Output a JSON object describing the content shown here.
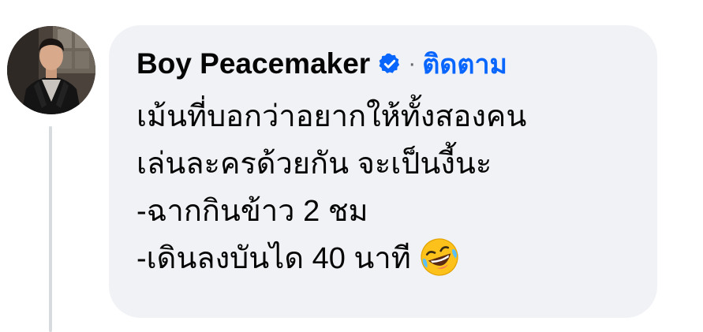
{
  "comment": {
    "author": "Boy Peacemaker",
    "separator": "·",
    "follow_label": "ติดตาม",
    "lines": [
      "เม้นที่บอกว่าอยากให้ทั้งสองคน",
      "เล่นละครด้วยกัน จะเป็นงี้นะ",
      "-ฉากกินข้าว 2 ชม",
      "-เดินลงบันได 40 นาที"
    ],
    "verified_icon": "verified-check-icon",
    "emoji": "rolling-on-floor-laughing-emoji"
  },
  "colors": {
    "bubble": "#f0f2f5",
    "link": "#0866ff",
    "text": "#050505",
    "muted": "#65676b",
    "thread_line": "#d7dade"
  }
}
